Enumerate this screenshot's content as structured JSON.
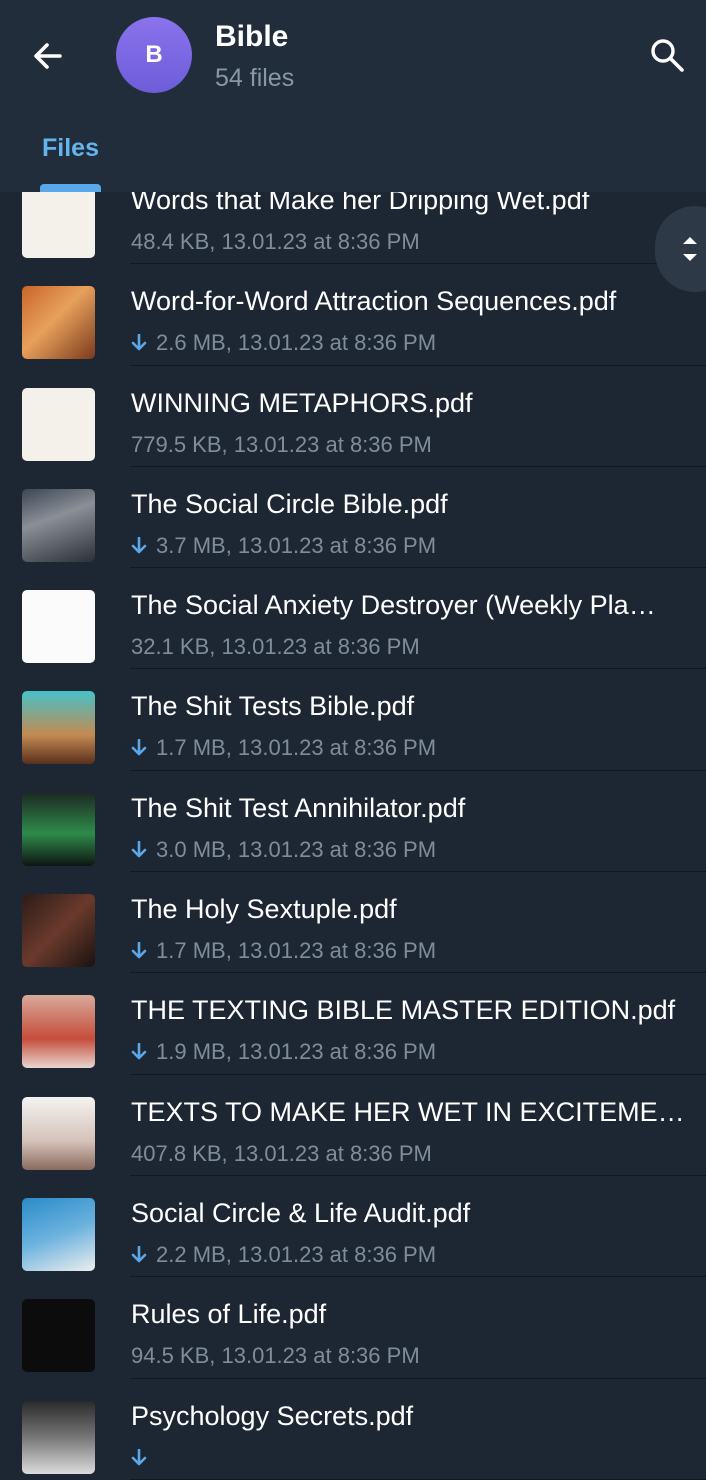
{
  "header": {
    "title": "Bible",
    "subtitle": "54 files",
    "avatar_letter": "B",
    "back_icon": "back-arrow-icon",
    "search_icon": "search-icon"
  },
  "tabs": [
    {
      "label": "Files",
      "active": true
    }
  ],
  "colors": {
    "background": "#1d2733",
    "header": "#212d3b",
    "accent": "#64b4f0",
    "download": "#5aa8ea",
    "avatar": "#7b68e6"
  },
  "files": [
    {
      "name": "Words that Make her Dripping Wet.pdf",
      "meta": "48.4 KB, 13.01.23 at 8:36 PM",
      "downloadable": false,
      "thumb": "t-red"
    },
    {
      "name": "Word-for-Word Attraction Sequences.pdf",
      "meta": "2.6 MB, 13.01.23 at 8:36 PM",
      "downloadable": true,
      "thumb": "t-orange"
    },
    {
      "name": "WINNING METAPHORS.pdf",
      "meta": "779.5 KB, 13.01.23 at 8:36 PM",
      "downloadable": false,
      "thumb": "t-white"
    },
    {
      "name": "The Social Circle Bible.pdf",
      "meta": "3.7 MB, 13.01.23 at 8:36 PM",
      "downloadable": true,
      "thumb": "t-crowd"
    },
    {
      "name": "The Social Anxiety Destroyer (Weekly Pla…",
      "meta": "32.1 KB, 13.01.23 at 8:36 PM",
      "downloadable": false,
      "thumb": "t-grid"
    },
    {
      "name": "The Shit Tests Bible.pdf",
      "meta": "1.7 MB, 13.01.23 at 8:36 PM",
      "downloadable": true,
      "thumb": "t-teal"
    },
    {
      "name": "The Shit Test Annihilator.pdf",
      "meta": "3.0 MB, 13.01.23 at 8:36 PM",
      "downloadable": true,
      "thumb": "t-green"
    },
    {
      "name": "The Holy Sextuple.pdf",
      "meta": "1.7 MB, 13.01.23 at 8:36 PM",
      "downloadable": true,
      "thumb": "t-dark"
    },
    {
      "name": "THE TEXTING BIBLE MASTER EDITION.pdf",
      "meta": "1.9 MB, 13.01.23 at 8:36 PM",
      "downloadable": true,
      "thumb": "t-pink"
    },
    {
      "name": "TEXTS TO MAKE HER WET IN EXCITEME…",
      "meta": "407.8 KB, 13.01.23 at 8:36 PM",
      "downloadable": false,
      "thumb": "t-light"
    },
    {
      "name": "Social Circle & Life Audit.pdf",
      "meta": "2.2 MB, 13.01.23 at 8:36 PM",
      "downloadable": true,
      "thumb": "t-blue"
    },
    {
      "name": "Rules of Life.pdf",
      "meta": "94.5 KB, 13.01.23 at 8:36 PM",
      "downloadable": false,
      "thumb": "t-black"
    },
    {
      "name": "Psychology Secrets.pdf",
      "meta": "",
      "downloadable": true,
      "thumb": "t-gray"
    }
  ]
}
